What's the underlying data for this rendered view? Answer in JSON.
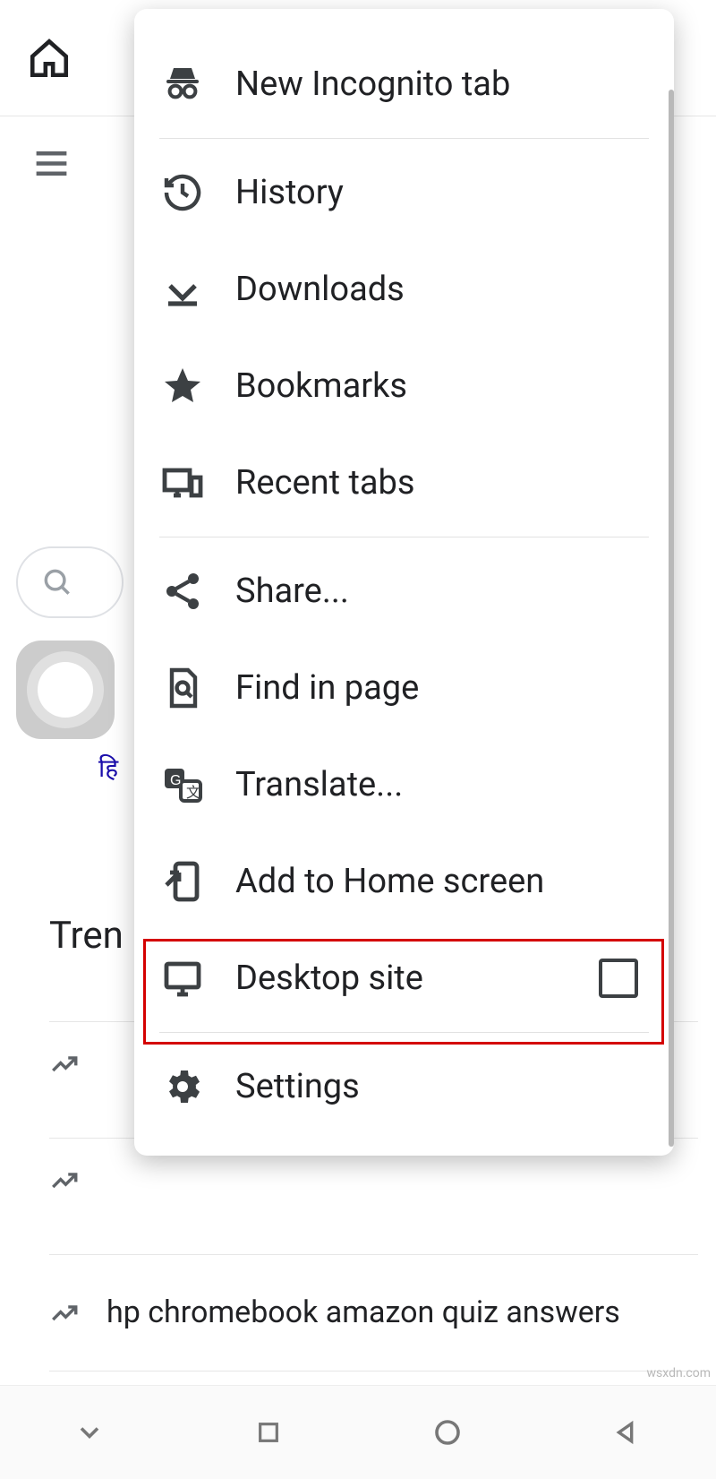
{
  "page": {
    "lang_link": "हि",
    "trending_title": "Tren",
    "trending_items": [
      "",
      "",
      "hp chromebook amazon quiz answers"
    ]
  },
  "menu": {
    "items": [
      {
        "label": "New Incognito tab"
      },
      {
        "label": "History"
      },
      {
        "label": "Downloads"
      },
      {
        "label": "Bookmarks"
      },
      {
        "label": "Recent tabs"
      },
      {
        "label": "Share..."
      },
      {
        "label": "Find in page"
      },
      {
        "label": "Translate..."
      },
      {
        "label": "Add to Home screen"
      },
      {
        "label": "Desktop site",
        "checked": false
      },
      {
        "label": "Settings"
      }
    ]
  },
  "watermark": "wsxdn.com"
}
